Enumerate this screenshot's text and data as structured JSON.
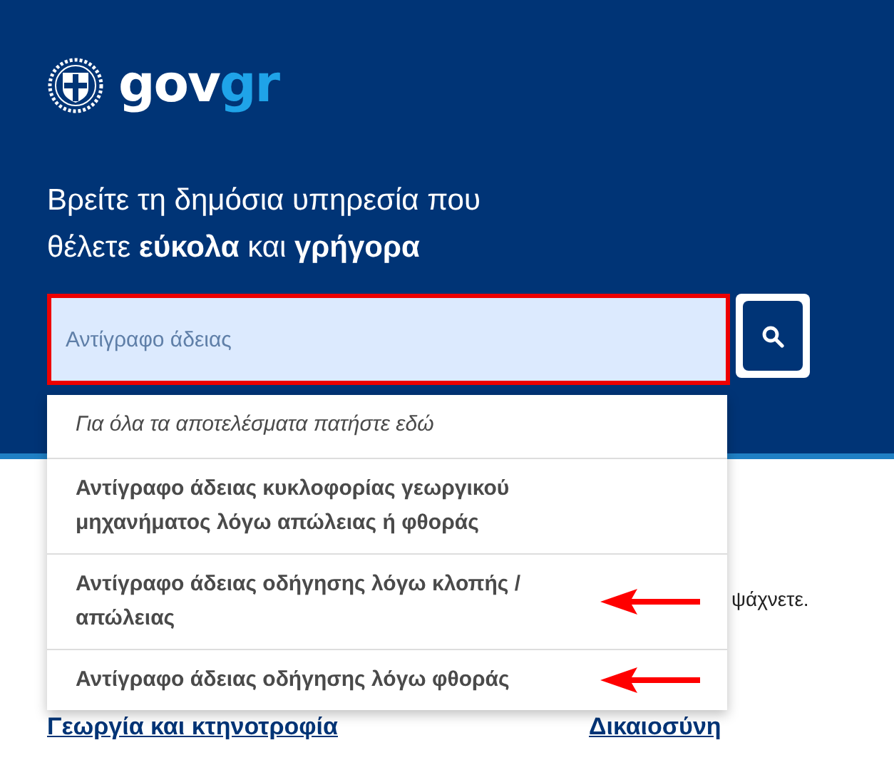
{
  "header": {
    "logo": {
      "part_1": "gov",
      "part_2": "gr"
    },
    "headline": "Βρείτε τη δημόσια υπηρεσία που θέλετε **εύκολα** και **γρήγορα**"
  },
  "search": {
    "value": "Αντίγραφο άδειας",
    "highlighted": true
  },
  "suggestions": [
    {
      "kind": "all",
      "label": "Για όλα τα αποτελέσματα πατήστε εδώ",
      "marked": false
    },
    {
      "kind": "result",
      "label": "Αντίγραφο άδειας κυκλοφορίας γεωργικού μηχανήματος λόγω απώλειας ή φθοράς",
      "marked": false
    },
    {
      "kind": "result",
      "label": "Αντίγραφο άδειας οδήγησης λόγω κλοπής / απώλειας",
      "marked": true
    },
    {
      "kind": "result",
      "label": "Αντίγραφο άδειας οδήγησης λόγω φθοράς",
      "marked": true
    }
  ],
  "intro_tail": "ψάχνετε.",
  "categories": [
    "Γεωργία και κτηνοτροφία",
    "Δικαιοσύνη"
  ]
}
